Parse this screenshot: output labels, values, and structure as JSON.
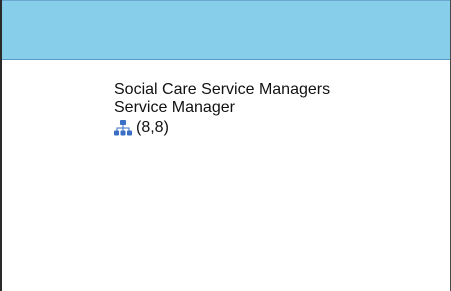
{
  "theme": {
    "header_color": "#87ceeb",
    "icon_color": "#3a6fc4"
  },
  "node": {
    "name": "Social Care Service Managers",
    "role": "Service Manager",
    "icon": "org-chart-icon",
    "count": "(8,8)"
  }
}
